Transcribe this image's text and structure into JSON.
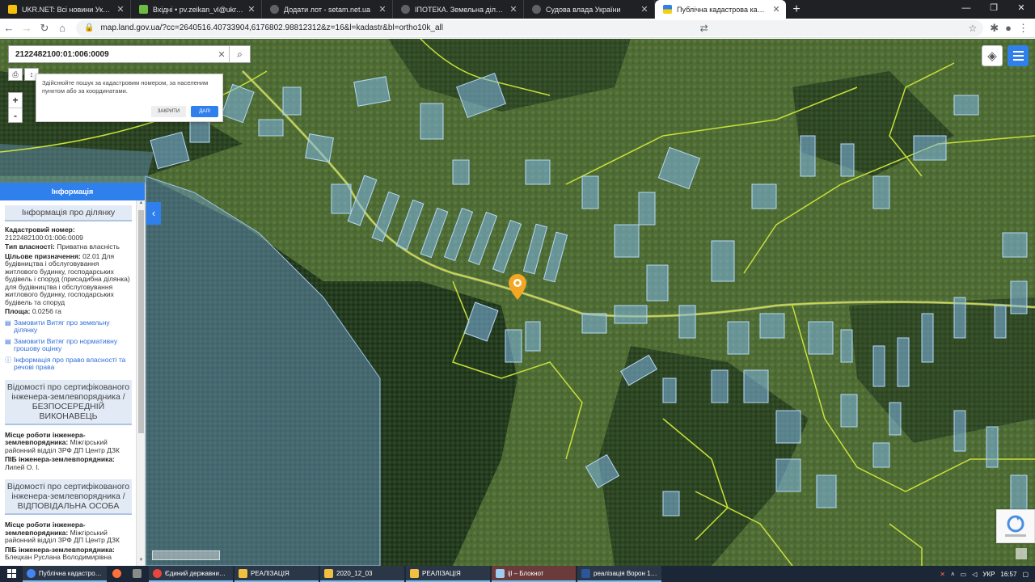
{
  "browser": {
    "tabs": [
      {
        "title": "UKR.NET: Всі новини України, ос",
        "color": "#f4c20d"
      },
      {
        "title": "Вхідні • pv.zeikan_vl@ukr.net",
        "color": "#6dba45"
      },
      {
        "title": "Додати лот - setam.net.ua",
        "color": "#5f6368"
      },
      {
        "title": "ІПОТЕКА. Земельна ділянка, заг",
        "color": "#5f6368"
      },
      {
        "title": "Судова влада України",
        "color": "#5f6368"
      },
      {
        "title": "Публічна кадастрова карта Укр",
        "color": "#2f80ed"
      }
    ],
    "url": "map.land.gov.ua/?cc=2640516.40733904,6176802.98812312&z=16&l=kadastr&bl=ortho10k_all"
  },
  "map": {
    "search_value": "2122482100:01:006:0009",
    "tip": {
      "text": "Здійснюйте пошук за кадастровим номером, за населеним пунктом або за координатами.",
      "close_label": "ЗАКРИТИ",
      "next_label": "ДАЛІ"
    },
    "zoom_in": "+",
    "zoom_out": "-"
  },
  "panel": {
    "header": "Інформація",
    "parcel_title": "Інформація про ділянку",
    "cadastral_label": "Кадастровий номер:",
    "cadastral_value": "2122482100:01:006:0009",
    "ownership_label": "Тип власності:",
    "ownership_value": "Приватна власність",
    "purpose_label": "Цільове призначення:",
    "purpose_value": "02.01 Для будівництва і обслуговування житлового будинку, господарських будівель і споруд (присадибна ділянка) для будівництва і обслуговування житлового будинку, господарських будівель та споруд",
    "area_label": "Площа:",
    "area_value": "0.0256 га",
    "links": [
      "Замовити Витяг про земельну ділянку",
      "Замовити Витяг про нормативну грошову оцінку",
      "Інформація про право власності та речові права"
    ],
    "engineer1_title": "Відомості про сертифікованого інженера-землевпорядника / БЕЗПОСЕРЕДНІЙ ВИКОНАВЕЦЬ",
    "engineer1_place_label": "Місце роботи інженера-землевпорядника:",
    "engineer1_place_value": "Міжгірський районний відділ ЗРФ ДП Центр ДЗК",
    "engineer1_name_label": "ПІБ інженера-землевпорядника:",
    "engineer1_name_value": "Липей О. І.",
    "engineer2_title": "Відомості про сертифікованого інженера-землевпорядника / ВІДПОВІДАЛЬНА ОСОБА",
    "engineer2_place_label": "Місце роботи інженера-землевпорядника:",
    "engineer2_place_value": "Міжгірський районний відділ ЗРФ ДП Центр ДЗК",
    "engineer2_name_label": "ПІБ інженера-землевпорядника:",
    "engineer2_name_value": "Блецкан Руслана Володимирівна"
  },
  "taskbar": {
    "apps": [
      {
        "label": "Публічна кадастров...",
        "color": "#4285f4"
      },
      {
        "label": "Єдиний державний ...",
        "color": "#e8453c"
      },
      {
        "label": "РЕАЛІЗАЦІЯ",
        "color": "#f0c040"
      },
      {
        "label": "2020_12_03",
        "color": "#f0c040"
      },
      {
        "label": "РЕАЛІЗАЦІЯ",
        "color": "#f0c040"
      },
      {
        "label": "ijl – Блокнот",
        "color": "#9ecbf0"
      },
      {
        "label": "реалізація Ворон 1.l...",
        "color": "#2b579a"
      }
    ],
    "lang": "УКР",
    "time": "16:57"
  },
  "colors": {
    "accent": "#2f80ed",
    "parcel_fill": "#7fb6e6",
    "boundary": "#c7e03a",
    "marker": "#f5a623"
  }
}
